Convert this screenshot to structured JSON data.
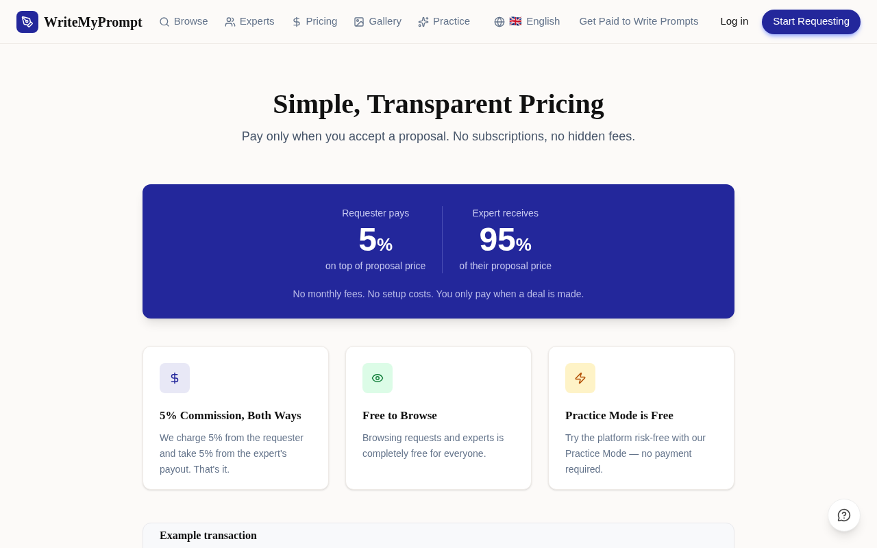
{
  "brand": "WriteMyPrompt",
  "nav": [
    {
      "label": "Browse",
      "kind": "search"
    },
    {
      "label": "Experts",
      "kind": "users"
    },
    {
      "label": "Pricing",
      "kind": "dollar"
    },
    {
      "label": "Gallery",
      "kind": "image"
    },
    {
      "label": "Practice",
      "kind": "sparkles"
    }
  ],
  "language": {
    "flag": "🇬🇧",
    "label": "English"
  },
  "earn_link": "Get Paid to Write Prompts",
  "login": "Log in",
  "cta": "Start Requesting",
  "hero": {
    "title": "Simple, Transparent Pricing",
    "subtitle": "Pay only when you accept a proposal. No subscriptions, no hidden fees."
  },
  "banner": {
    "stats": [
      {
        "label": "Requester pays",
        "value": "5",
        "unit": "%",
        "caption": "on top of proposal price"
      },
      {
        "label": "Expert receives",
        "value": "95",
        "unit": "%",
        "caption": "of their proposal price"
      }
    ],
    "note": "No monthly fees. No setup costs. You only pay when a deal is made."
  },
  "features": [
    {
      "kind": "dollar",
      "color": "#e8e8f6",
      "title": "5% Commission, Both Ways",
      "text": "We charge 5% from the requester and take 5% from the expert's payout. That's it."
    },
    {
      "kind": "eye",
      "color": "#dcfce7",
      "title": "Free to Browse",
      "text": "Browsing requests and experts is completely free for everyone."
    },
    {
      "kind": "zap",
      "color": "#fef3c7",
      "title": "Practice Mode is Free",
      "text": "Try the platform risk-free with our Practice Mode — no payment required."
    }
  ],
  "example": {
    "title": "Example transaction"
  }
}
